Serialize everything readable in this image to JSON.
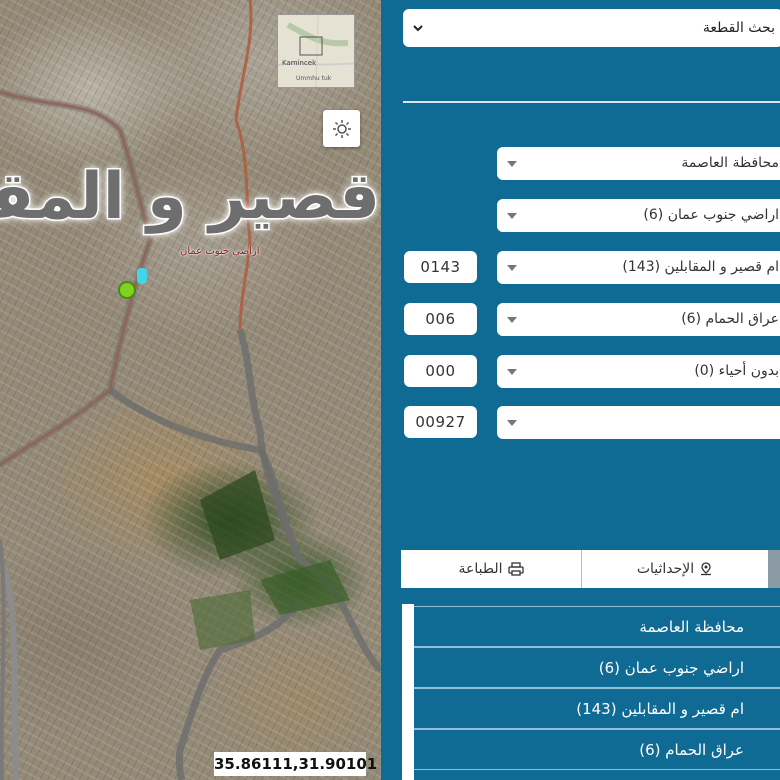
{
  "map": {
    "label_big": "قصير و المقابلين",
    "label_small": "اراضي جنوب عمان",
    "minimap": {
      "label1": "Kamincek",
      "label2": "Ummhu tuk"
    },
    "coordinates": "35.86111,31.90101",
    "basemap_icon": "sun-icon"
  },
  "panel": {
    "top_select": "بحث القطعة",
    "fields": [
      {
        "label": "محافظة العاصمة",
        "code": ""
      },
      {
        "label": "اراضي جنوب عمان (6)",
        "code": ""
      },
      {
        "label": "ام قصير و المقابلين (143)",
        "code": "0143"
      },
      {
        "label": "عراق الحمام (6)",
        "code": "006"
      },
      {
        "label": "بدون أحياء (0)",
        "code": "000"
      },
      {
        "label": "",
        "code": "00927"
      }
    ],
    "tabs": {
      "print": "الطباعة",
      "coords": "الإحداثيات"
    },
    "results": [
      "محافظة العاصمة",
      "اراضي جنوب عمان (6)",
      "ام قصير و المقابلين (143)",
      "عراق الحمام (6)"
    ]
  },
  "colors": {
    "panel_bg": "#0f6b93",
    "marker": "#7ed321",
    "boundary": "#6d6d6d"
  }
}
